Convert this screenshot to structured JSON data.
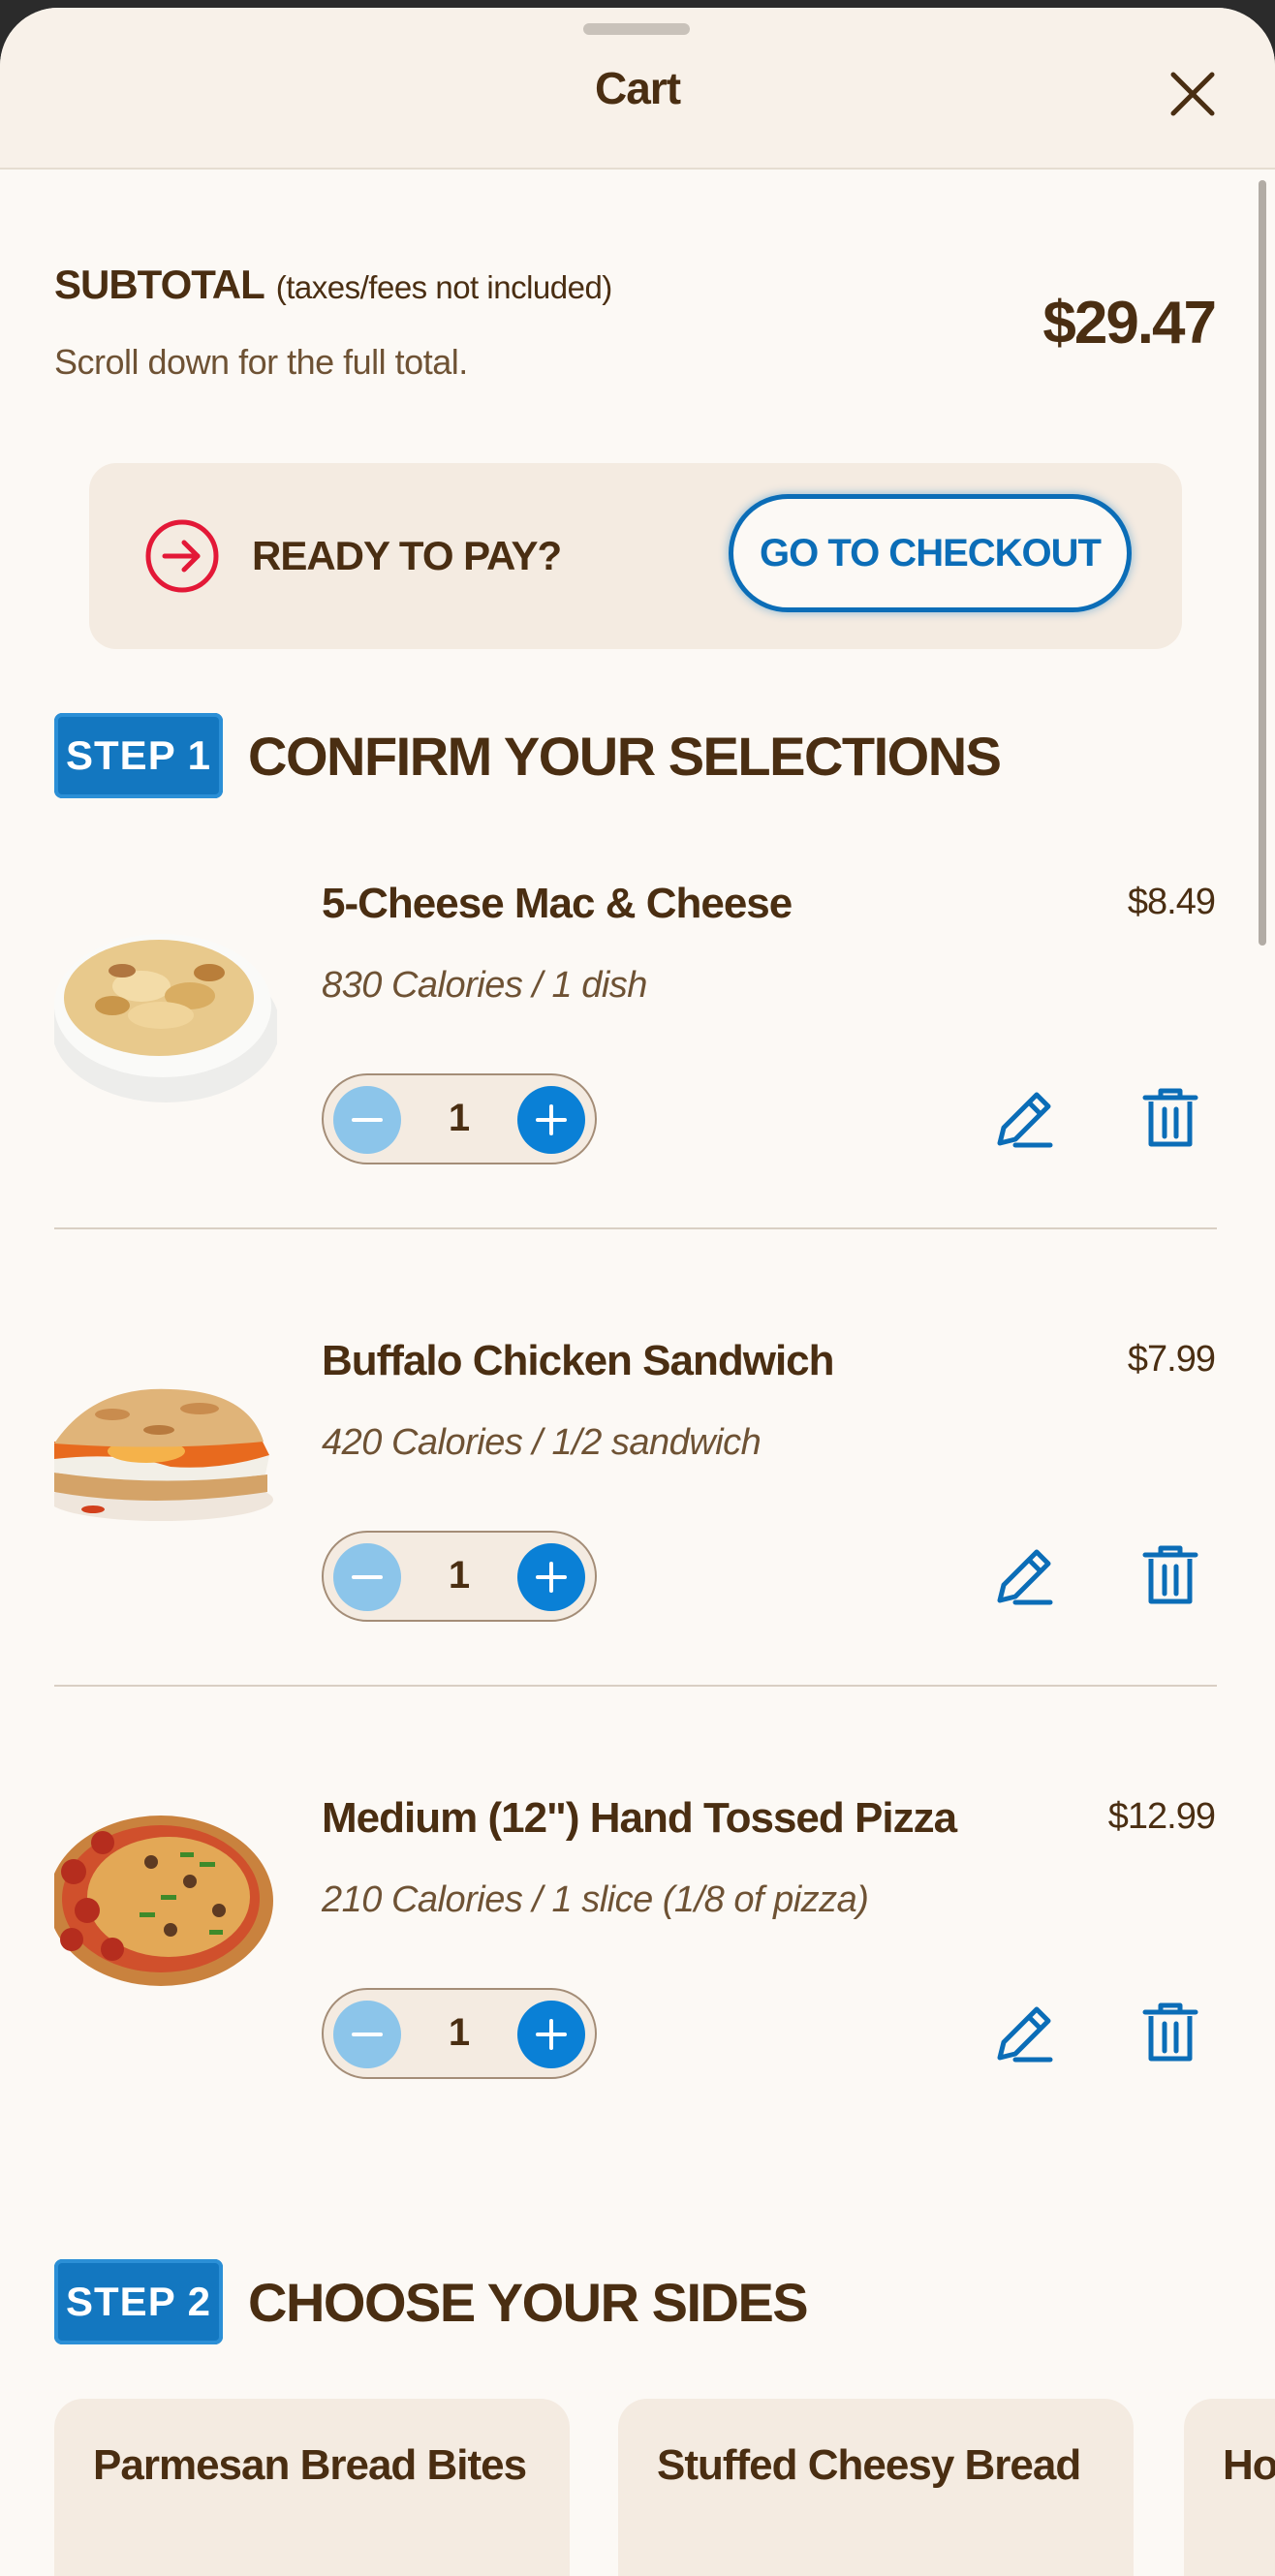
{
  "sheet": {
    "title": "Cart",
    "close_icon": "close-icon"
  },
  "subtotal": {
    "label": "SUBTOTAL",
    "qualifier": "(taxes/fees not included)",
    "note": "Scroll down for the full total.",
    "amount": "$29.47"
  },
  "pay_prompt": {
    "icon": "arrow-right-circle-icon",
    "label": "READY TO PAY?",
    "button_label": "GO TO CHECKOUT"
  },
  "step1": {
    "badge": "STEP 1",
    "title": "CONFIRM YOUR SELECTIONS"
  },
  "cart_items": [
    {
      "name": "5-Cheese Mac & Cheese",
      "price": "$8.49",
      "calories": "830 Calories / 1 dish",
      "quantity": "1",
      "image": "mac-and-cheese-dish"
    },
    {
      "name": "Buffalo Chicken Sandwich",
      "price": "$7.99",
      "calories": "420 Calories / 1/2 sandwich",
      "quantity": "1",
      "image": "buffalo-chicken-sandwich"
    },
    {
      "name": "Medium (12\") Hand Tossed Pizza",
      "price": "$12.99",
      "calories": "210 Calories / 1 slice (1/8 of pizza)",
      "quantity": "1",
      "image": "hand-tossed-pizza"
    }
  ],
  "step2": {
    "badge": "STEP 2",
    "title": "CHOOSE YOUR SIDES"
  },
  "sides": [
    {
      "name": "Parmesan Bread Bites"
    },
    {
      "name": "Stuffed Cheesy Bread"
    },
    {
      "name": "Hot"
    }
  ],
  "colors": {
    "brown_text": "#4a2e12",
    "accent_blue": "#0b6db7",
    "sheet_bg": "#fcf9f5",
    "panel_bg": "#f4ebe1",
    "arrow_red": "#e31837"
  }
}
